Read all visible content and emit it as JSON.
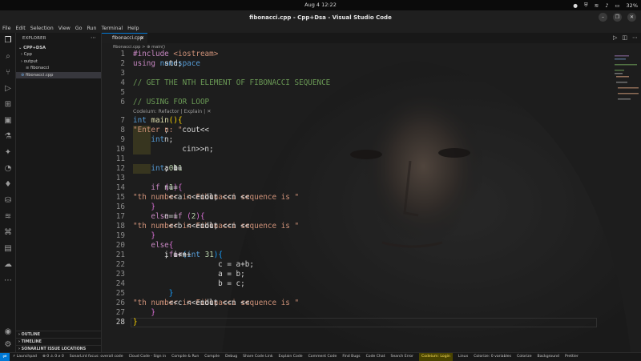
{
  "system": {
    "clock": "Aug 4  12:22",
    "battery": "32%"
  },
  "window": {
    "title": "fibonacci.cpp - Cpp+Dsa - Visual Studio Code"
  },
  "menu": [
    "File",
    "Edit",
    "Selection",
    "View",
    "Go",
    "Run",
    "Terminal",
    "Help"
  ],
  "activity_bar": [
    "files-icon",
    "search-icon",
    "source-control-icon",
    "run-debug-icon",
    "extensions-icon",
    "remote-explorer-icon",
    "testing-icon",
    "codeium-icon",
    "sonarlint-icon",
    "mongodb-icon",
    "database-icon",
    "stack-icon",
    "python-icon",
    "folder-icon",
    "docker-icon"
  ],
  "sidebar": {
    "header": "EXPLORER",
    "workspace": "CPP+DSA",
    "tree": [
      {
        "label": "Cpp",
        "kind": "folder",
        "depth": 0
      },
      {
        "label": "output",
        "kind": "folder",
        "depth": 0
      },
      {
        "label": "fibonacci",
        "kind": "file",
        "depth": 1
      },
      {
        "label": "fibonacci.cpp",
        "kind": "cpp",
        "depth": 0,
        "selected": true
      }
    ],
    "sections": [
      "OUTLINE",
      "TIMELINE",
      "SONARLINT ISSUE LOCATIONS"
    ]
  },
  "editor": {
    "tab": "fibonacci.cpp",
    "breadcrumb": "fibonacci.cpp > ⊕ main()",
    "codelens": "Codeium: Refactor | Explain | ✕",
    "lines": [
      [
        [
          "kw",
          "#include "
        ],
        [
          "str",
          "<iostream>"
        ]
      ],
      [
        [
          "kw",
          "using "
        ],
        [
          "ty",
          "namespace "
        ],
        [
          "txt",
          "std;"
        ]
      ],
      [],
      [
        [
          "cm",
          "// GET THE NTH ELEMENT OF FIBONACCI SEQUENCE"
        ]
      ],
      [],
      [
        [
          "cm",
          "// USING FOR LOOP"
        ]
      ],
      [
        [
          "ty",
          "int "
        ],
        [
          "fn",
          "main"
        ],
        [
          "br",
          "(){"
        ]
      ],
      [
        [
          "txt",
          "    cout<<"
        ],
        [
          "str",
          "\"Enter n: \""
        ],
        [
          "txt",
          ";"
        ]
      ],
      [
        [
          "ty",
          "    int "
        ],
        [
          "txt",
          "n;"
        ]
      ],
      [
        [
          "txt",
          "    cin>>n;"
        ]
      ],
      [],
      [
        [
          "ty",
          "    int "
        ],
        [
          "txt",
          "a = "
        ],
        [
          "num",
          "0"
        ],
        [
          "txt",
          ", b="
        ],
        [
          "num",
          "1"
        ],
        [
          "txt",
          ", c="
        ],
        [
          "num",
          "1"
        ],
        [
          "txt",
          ";"
        ]
      ],
      [],
      [
        [
          "kw",
          "    if "
        ],
        [
          "br2",
          "("
        ],
        [
          "txt",
          "n=="
        ],
        [
          "num",
          "1"
        ],
        [
          "br2",
          "){"
        ]
      ],
      [
        [
          "txt",
          "        cout <<n <<"
        ],
        [
          "str",
          "\"th number in Fibonacci sequence is \""
        ],
        [
          "txt",
          " <<a <<endl;"
        ]
      ],
      [
        [
          "br2",
          "    }"
        ]
      ],
      [
        [
          "kw",
          "    else if "
        ],
        [
          "br2",
          "("
        ],
        [
          "txt",
          "n=="
        ],
        [
          "num",
          "2"
        ],
        [
          "br2",
          "){"
        ]
      ],
      [
        [
          "txt",
          "        cout <<n <<"
        ],
        [
          "str",
          "\"th number in Fibonacci sequence is \""
        ],
        [
          "txt",
          " <<b <<endl;"
        ]
      ],
      [
        [
          "br2",
          "    }"
        ]
      ],
      [
        [
          "kw",
          "    else"
        ],
        [
          "br2",
          "{"
        ]
      ],
      [
        [
          "kw",
          "        for"
        ],
        [
          "br3",
          "("
        ],
        [
          "ty",
          "int "
        ],
        [
          "txt",
          "i = "
        ],
        [
          "num",
          "3"
        ],
        [
          "txt",
          "; i<n+"
        ],
        [
          "num",
          "1"
        ],
        [
          "txt",
          "; i++"
        ],
        [
          "br3",
          "){"
        ]
      ],
      [
        [
          "txt",
          "            c = a+b;"
        ]
      ],
      [
        [
          "txt",
          "            a = b;"
        ]
      ],
      [
        [
          "txt",
          "            b = c;"
        ]
      ],
      [
        [
          "br3",
          "        }"
        ]
      ],
      [
        [
          "txt",
          "        cout <<n <<"
        ],
        [
          "str",
          "\"th number in Fibonacci sequence is \""
        ],
        [
          "txt",
          " <<c <<endl;"
        ]
      ],
      [
        [
          "br2",
          "    }"
        ]
      ],
      [
        [
          "br",
          "}"
        ]
      ]
    ]
  },
  "statusbar": {
    "items": [
      {
        "text": "⚡ Launchpad"
      },
      {
        "text": "⊗ 0 ⚠ 0  ⌀ 0"
      },
      {
        "text": "SonarLint focus: overall code"
      },
      {
        "text": "Cloud Code - Sign in"
      },
      {
        "text": "Compile & Run"
      },
      {
        "text": "Compile"
      },
      {
        "text": "Debug"
      },
      {
        "text": "Share Code Link"
      },
      {
        "text": "Explain Code"
      },
      {
        "text": "Comment Code"
      },
      {
        "text": "Find Bugs"
      },
      {
        "text": "Code Chat"
      },
      {
        "text": "Search Error"
      },
      {
        "text": "Codeium: Login",
        "warn": true
      },
      {
        "text": "Linux"
      },
      {
        "text": "Colorize: 0 variables"
      },
      {
        "text": "Colorize"
      },
      {
        "text": "Background"
      },
      {
        "text": "Prettier"
      }
    ]
  }
}
